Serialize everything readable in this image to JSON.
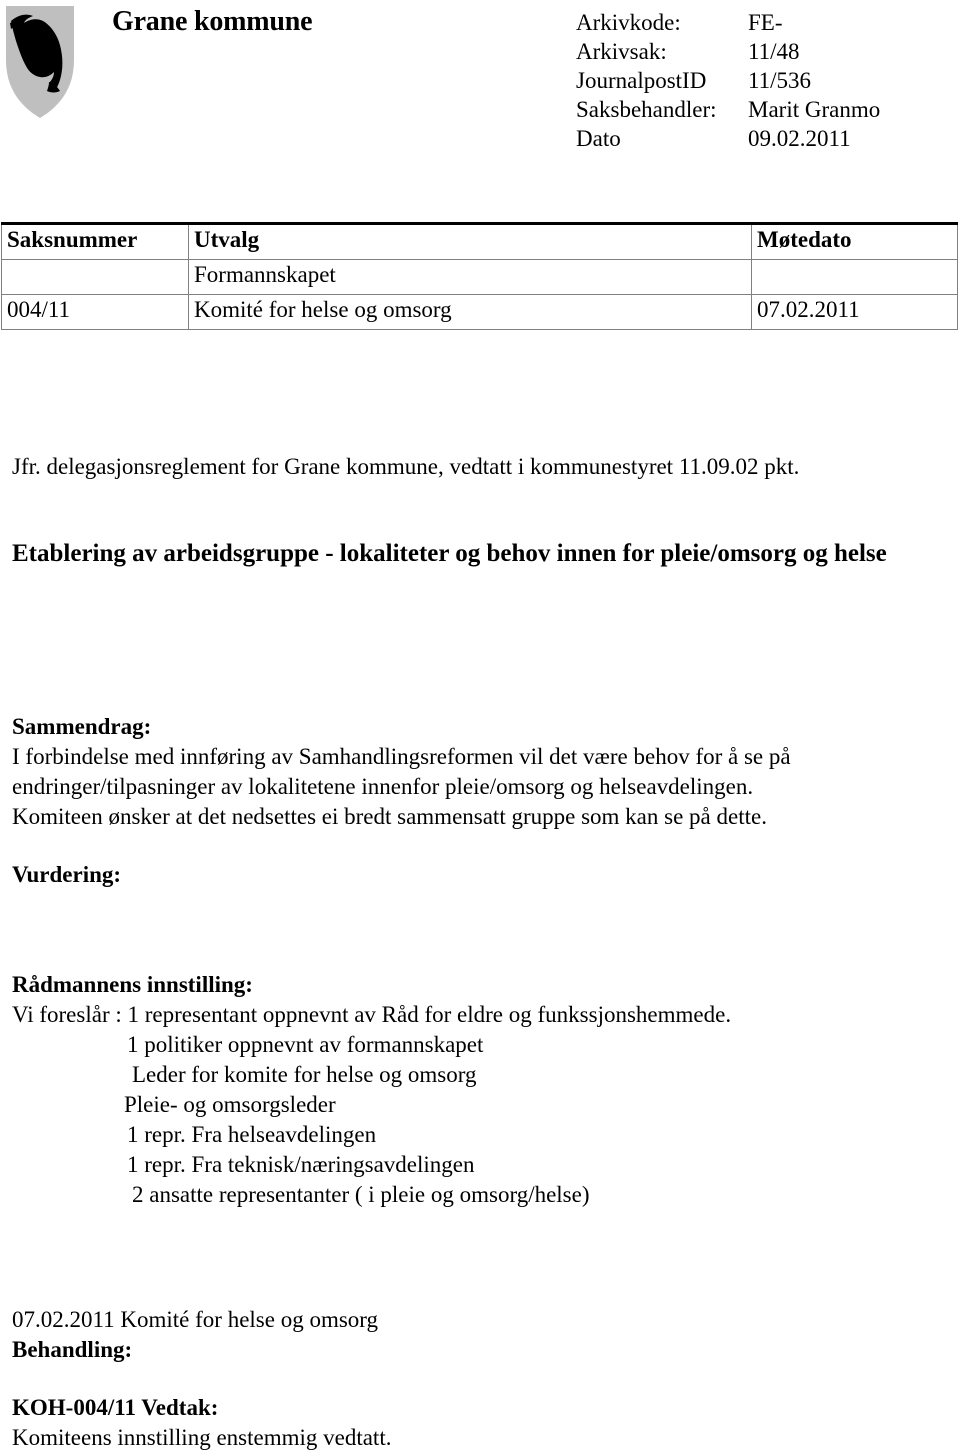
{
  "header": {
    "crest_icon": "grane-kommune-coat-of-arms-salmon-shield",
    "crest_shield_color": "#bfbfbf",
    "crest_charge_color": "#000000",
    "org_title": "Grane kommune",
    "meta": [
      {
        "label": "Arkivkode:",
        "value": "FE-"
      },
      {
        "label": "Arkivsak:",
        "value": "11/48"
      },
      {
        "label": "JournalpostID",
        "value": "11/536"
      },
      {
        "label": "Saksbehandler:",
        "value": "Marit Granmo"
      },
      {
        "label": "Dato",
        "value": "09.02.2011"
      }
    ]
  },
  "utvalg_table": {
    "columns": [
      "Saksnummer",
      "Utvalg",
      "Møtedato"
    ],
    "rows": [
      {
        "saksnummer": "",
        "utvalg": "Formannskapet",
        "motedato": ""
      },
      {
        "saksnummer": "004/11",
        "utvalg": "Komité for helse og omsorg",
        "motedato": "07.02.2011"
      }
    ]
  },
  "body": {
    "jfr_line": "Jfr. delegasjonsreglement for Grane kommune, vedtatt i kommunestyret 11.09.02 pkt.",
    "doc_title": "Etablering av arbeidsgruppe - lokaliteter og behov innen for pleie/omsorg og helse",
    "sammendrag": {
      "heading": "Sammendrag:",
      "lines": [
        "I forbindelse med innføring av Samhandlingsreformen vil det være behov for å se på",
        "endringer/tilpasninger av lokalitetene innenfor pleie/omsorg og helseavdelingen.",
        "Komiteen ønsker at det nedsettes ei bredt sammensatt gruppe som kan se på dette."
      ]
    },
    "vurdering": {
      "heading": "Vurdering:"
    },
    "innstilling": {
      "heading": "Rådmannens innstilling:",
      "first_line": "Vi foreslår : 1 representant oppnevnt av  Råd for eldre og funkssjonshemmede.",
      "items": [
        "1 politiker oppnevnt av formannskapet",
        "Leder for komite for helse og omsorg",
        "Pleie- og omsorgsleder",
        "1 repr. Fra helseavdelingen",
        "1 repr. Fra teknisk/næringsavdelingen",
        "2 ansatte representanter ( i pleie og omsorg/helse)"
      ]
    },
    "behandling": {
      "meeting_line": "07.02.2011 Komité for helse og omsorg",
      "heading": "Behandling:"
    },
    "vedtak": {
      "heading": "KOH-004/11 Vedtak:",
      "text": "Komiteens innstilling enstemmig vedtatt."
    }
  }
}
